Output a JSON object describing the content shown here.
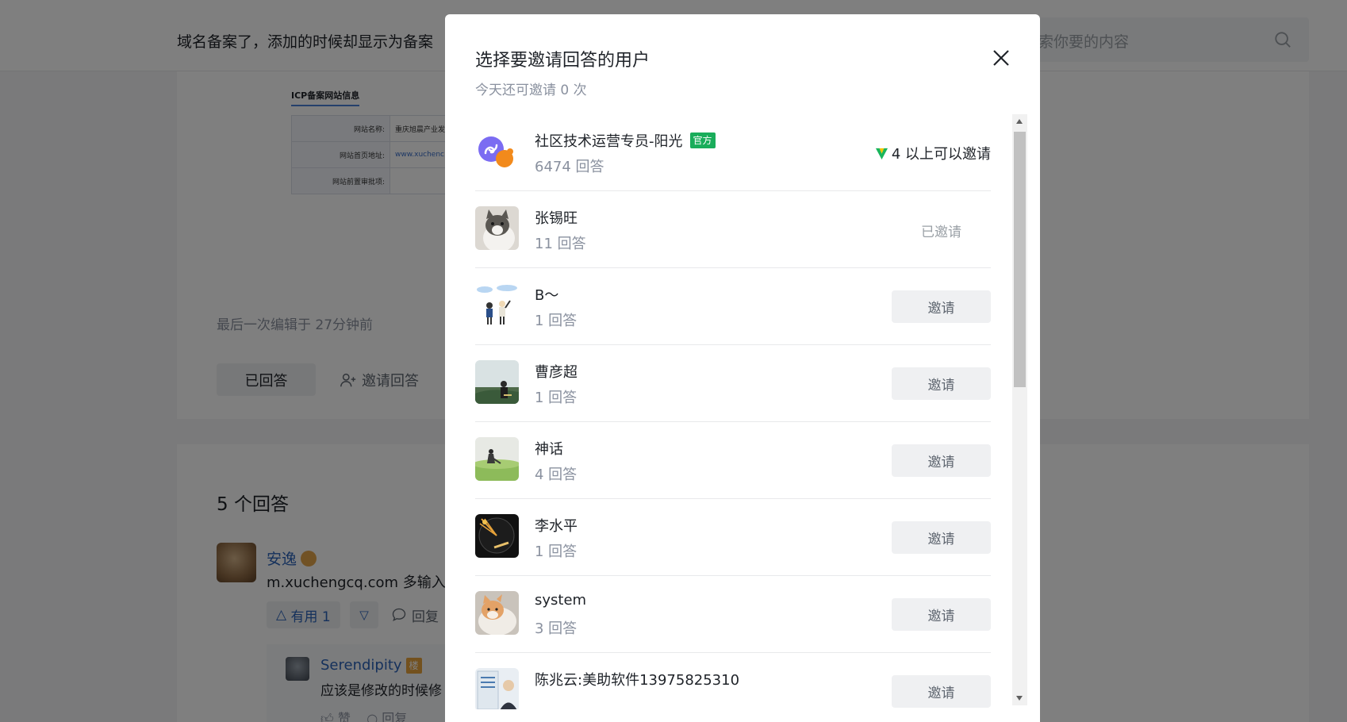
{
  "background": {
    "question_title": "域名备案了，添加的时候却显示为备案",
    "search_placeholder": "搜索你要的内容",
    "icp": {
      "tab_label": "ICP备案网站信息",
      "rows": [
        {
          "key": "网站名称:",
          "value": "重庆旭晨产业发"
        },
        {
          "key": "网站首页地址:",
          "value": "www.xuchenc"
        },
        {
          "key": "网站前置审批项:",
          "value": ""
        }
      ]
    },
    "edited_text": "最后一次编辑于  27分钟前",
    "answered_label": "已回答",
    "invite_answer_label": "邀请回答",
    "answers_count": "5 个回答",
    "answer": {
      "author": "安逸",
      "text": "m.xuchengcq.com 多输入了",
      "useful_label": "有用 1",
      "reply_label": "回复"
    },
    "sub_comment": {
      "author": "Serendipity",
      "floor_badge": "楼",
      "text": "应该是修改的时候修",
      "like_label": "赞",
      "reply_label": "回复"
    }
  },
  "modal": {
    "title": "选择要邀请回答的用户",
    "subtitle": "今天还可邀请 0 次",
    "users": [
      {
        "name": "社区技术运营专员-阳光",
        "badge": "官方",
        "answers": "6474 回答",
        "action": "level",
        "action_label": "4 以上可以邀请",
        "avatar": "link-logo"
      },
      {
        "name": "张锡旺",
        "answers": "11 回答",
        "action": "invited",
        "action_label": "已邀请",
        "avatar": "cat-photo"
      },
      {
        "name": "B～",
        "answers": "1 回答",
        "action": "invite",
        "action_label": "邀请",
        "avatar": "cartoon-people"
      },
      {
        "name": "曹彦超",
        "answers": "1 回答",
        "action": "invite",
        "action_label": "邀请",
        "avatar": "landscape-person"
      },
      {
        "name": "神话",
        "answers": "4 回答",
        "action": "invite",
        "action_label": "邀请",
        "avatar": "grass-girl"
      },
      {
        "name": "李水平",
        "answers": "1 回答",
        "action": "invite",
        "action_label": "邀请",
        "avatar": "future-logo"
      },
      {
        "name": "system",
        "answers": "3 回答",
        "action": "invite",
        "action_label": "邀请",
        "avatar": "cat-orange"
      },
      {
        "name": "陈兆云:美助软件13975825310",
        "answers": "",
        "action": "invite",
        "action_label": "邀请",
        "avatar": "doc-person"
      }
    ]
  },
  "colors": {
    "link": "#2b62b8",
    "official_badge": "#1aad5b",
    "overlay": "rgba(0,0,0,0.5)"
  }
}
